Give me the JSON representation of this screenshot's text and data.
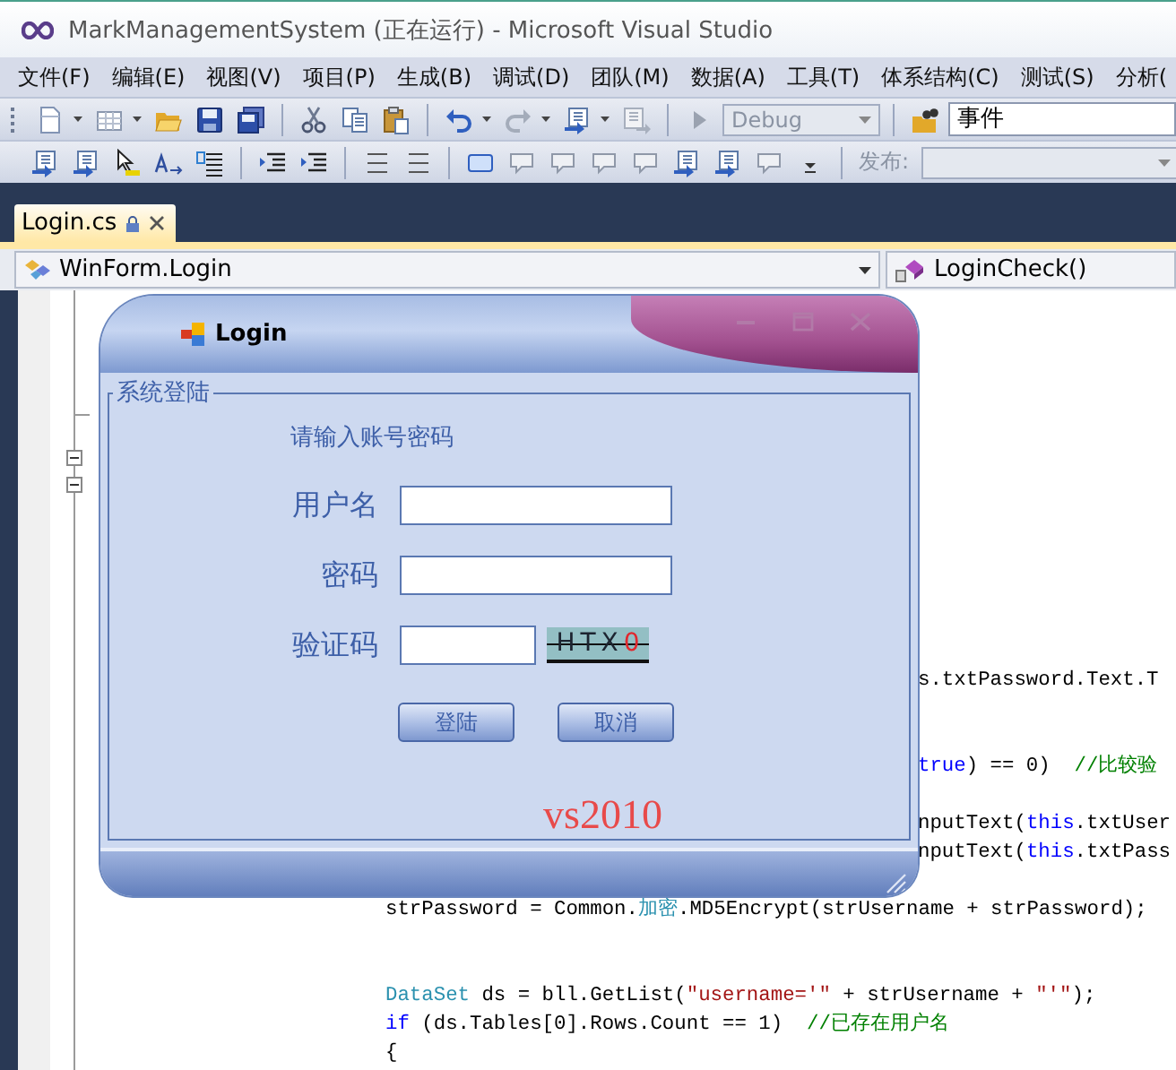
{
  "window": {
    "title": "MarkManagementSystem (正在运行) - Microsoft Visual Studio"
  },
  "menu": [
    "文件(F)",
    "编辑(E)",
    "视图(V)",
    "项目(P)",
    "生成(B)",
    "调试(D)",
    "团队(M)",
    "数据(A)",
    "工具(T)",
    "体系结构(C)",
    "测试(S)",
    "分析("
  ],
  "toolbar": {
    "configuration": {
      "value": "Debug",
      "disabled": true
    },
    "find_field": {
      "value": "事件"
    },
    "publish": {
      "label": "发布:",
      "disabled": true
    }
  },
  "tabs": [
    {
      "label": "Login.cs",
      "selected": true,
      "locked": true
    }
  ],
  "navigation": {
    "type_dropdown": "WinForm.Login",
    "member_dropdown": "LoginCheck()"
  },
  "code_lines": [
    {
      "kind": "clipped",
      "segments": [
        {
          "kind": "plain",
          "text": "s.txtPassword.Text.T"
        }
      ]
    },
    {
      "kind": "blank"
    },
    {
      "kind": "blank"
    },
    {
      "kind": "clipped",
      "segments": [
        {
          "kind": "keyword",
          "text": "true"
        },
        {
          "kind": "plain",
          "text": ") == 0)  "
        },
        {
          "kind": "comment",
          "text": "//比较验"
        }
      ]
    },
    {
      "kind": "blank"
    },
    {
      "kind": "clipped",
      "segments": [
        {
          "kind": "plain",
          "text": "nputText("
        },
        {
          "kind": "keyword",
          "text": "this"
        },
        {
          "kind": "plain",
          "text": ".txtUser"
        }
      ]
    },
    {
      "kind": "clipped",
      "segments": [
        {
          "kind": "plain",
          "text": "nputText("
        },
        {
          "kind": "keyword",
          "text": "this"
        },
        {
          "kind": "plain",
          "text": ".txtPass"
        }
      ]
    },
    {
      "kind": "blank"
    },
    {
      "kind": "code",
      "segments": [
        {
          "kind": "plain",
          "text": "strPassword = Common."
        },
        {
          "kind": "type",
          "text": "加密"
        },
        {
          "kind": "plain",
          "text": ".MD5Encrypt(strUsername + strPassword);"
        }
      ]
    },
    {
      "kind": "blank"
    },
    {
      "kind": "blank"
    },
    {
      "kind": "code",
      "segments": [
        {
          "kind": "type",
          "text": "DataSet"
        },
        {
          "kind": "plain",
          "text": " ds = bll.GetList("
        },
        {
          "kind": "string",
          "text": "\"username='\""
        },
        {
          "kind": "plain",
          "text": " + strUsername + "
        },
        {
          "kind": "string",
          "text": "\"'\""
        },
        {
          "kind": "plain",
          "text": ");"
        }
      ]
    },
    {
      "kind": "code",
      "segments": [
        {
          "kind": "keyword",
          "text": "if"
        },
        {
          "kind": "plain",
          "text": " (ds.Tables[0].Rows.Count == 1)  "
        },
        {
          "kind": "comment",
          "text": "//已存在用户名"
        }
      ]
    },
    {
      "kind": "code",
      "segments": [
        {
          "kind": "plain",
          "text": "{"
        }
      ]
    }
  ],
  "dialog": {
    "title": "Login",
    "group_title": "系统登陆",
    "prompt": "请输入账号密码",
    "fields": [
      {
        "label": "用户名",
        "kind": "text"
      },
      {
        "label": "密码",
        "kind": "text"
      },
      {
        "label": "验证码",
        "kind": "captcha"
      }
    ],
    "captcha": [
      {
        "char": "H",
        "color": "#1c2430"
      },
      {
        "char": "T",
        "color": "#1c2430"
      },
      {
        "char": "X",
        "color": "#1c2430"
      },
      {
        "char": "0",
        "color": "#e0282e"
      }
    ],
    "buttons": [
      "登陆",
      "取消"
    ],
    "note": "vs2010"
  }
}
